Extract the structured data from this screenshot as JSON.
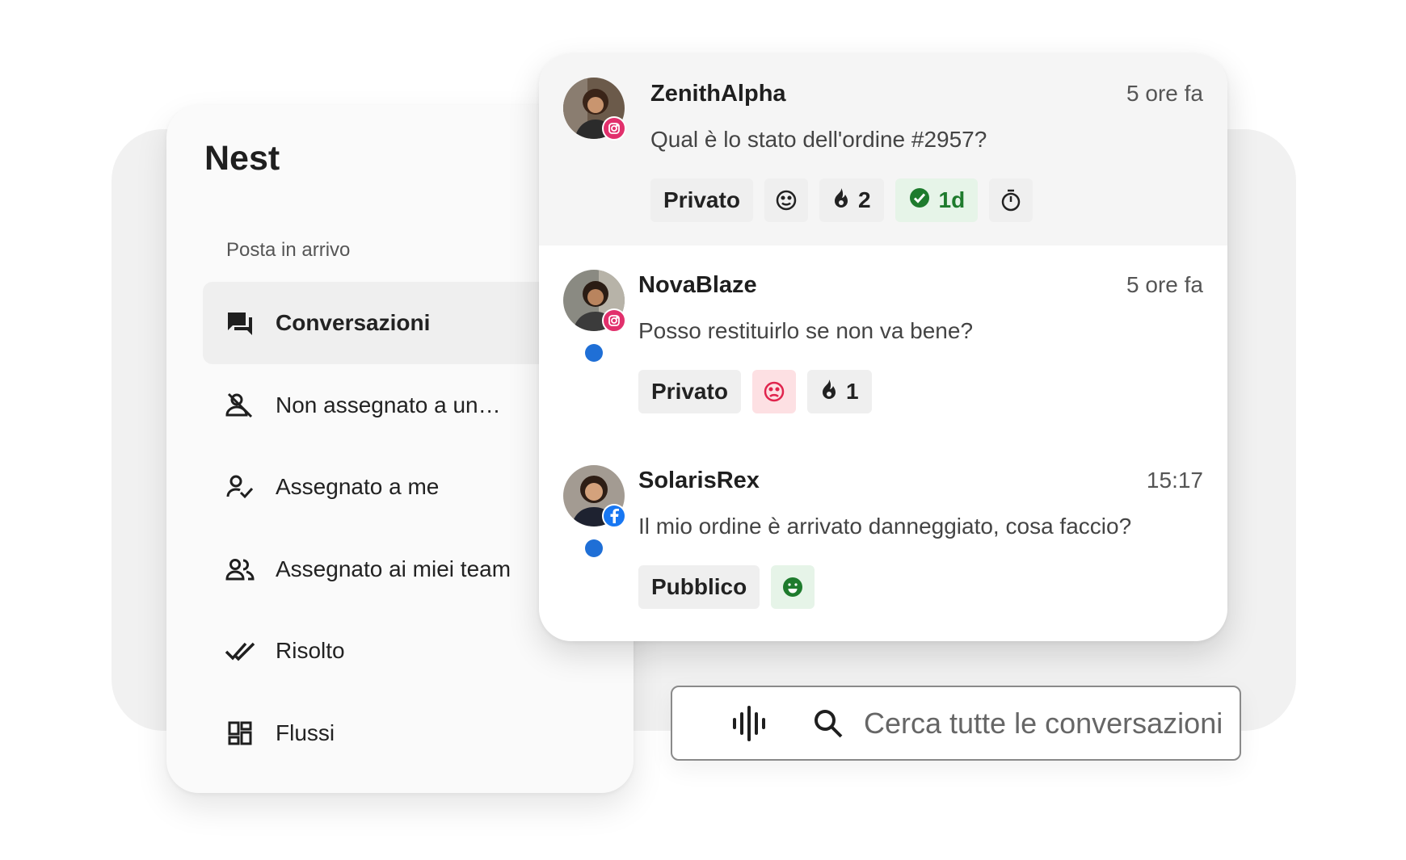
{
  "sidebar": {
    "brand": "Nest",
    "section_label": "Posta in arrivo",
    "items": [
      {
        "label": "Conversazioni",
        "icon": "chat-bubbles-icon",
        "active": true
      },
      {
        "label": "Non assegnato a un…",
        "icon": "unassigned-person-icon",
        "active": false
      },
      {
        "label": "Assegnato a me",
        "icon": "person-check-icon",
        "active": false
      },
      {
        "label": "Assegnato ai miei team",
        "icon": "team-icon",
        "active": false
      },
      {
        "label": "Risolto",
        "icon": "double-check-icon",
        "active": false
      },
      {
        "label": "Flussi",
        "icon": "dashboard-grid-icon",
        "active": false
      }
    ]
  },
  "conversations": [
    {
      "name": "ZenithAlpha",
      "time": "5 ore fa",
      "message": "Qual è lo stato dell'ordine #2957?",
      "channel": "instagram-icon",
      "unread": false,
      "tags": {
        "visibility": "Privato",
        "sentiment": "neutral-face-icon",
        "priority_count": "2",
        "sla": "1d",
        "timer": "stopwatch-icon"
      }
    },
    {
      "name": "NovaBlaze",
      "time": "5 ore fa",
      "message": "Posso restituirlo se non va bene?",
      "channel": "instagram-icon",
      "unread": true,
      "tags": {
        "visibility": "Privato",
        "sentiment": "sad-face-icon",
        "priority_count": "1"
      }
    },
    {
      "name": "SolarisRex",
      "time": "15:17",
      "message": "Il mio ordine è arrivato danneggiato, cosa faccio?",
      "channel": "facebook-icon",
      "unread": true,
      "tags": {
        "visibility": "Pubblico",
        "sentiment": "happy-face-icon"
      }
    }
  ],
  "search": {
    "placeholder": "Cerca tutte le conversazioni",
    "voice_icon": "voice-waveform-icon",
    "search_icon": "search-icon"
  },
  "colors": {
    "accent_blue": "#1f6fd6",
    "instagram": "#e1306c",
    "facebook": "#1877f2",
    "positive": "#1e7b2d",
    "negative": "#e0244d"
  }
}
